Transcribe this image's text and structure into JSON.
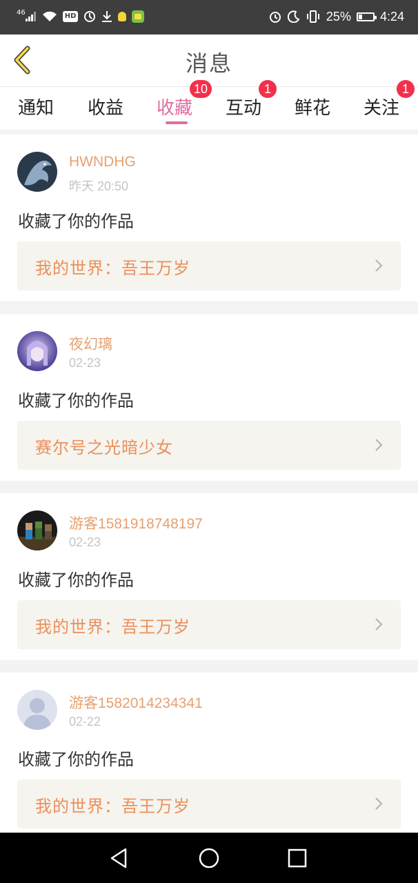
{
  "status_bar": {
    "signal_label": "46",
    "hd_label": "HD",
    "battery": "25%",
    "battery_level": 0.25,
    "time": "4:24",
    "icons": [
      "signal-icon",
      "wifi-icon",
      "hd-icon",
      "data-saver-icon",
      "download-icon",
      "bulb-icon",
      "app-icon",
      "alarm-icon",
      "moon-icon",
      "vibrate-icon",
      "battery-icon"
    ]
  },
  "header": {
    "title": "消息",
    "back_icon": "chevron-left-icon"
  },
  "tabs": [
    {
      "label": "通知",
      "badge": "",
      "active": false
    },
    {
      "label": "收益",
      "badge": "",
      "active": false
    },
    {
      "label": "收藏",
      "badge": "10",
      "active": true
    },
    {
      "label": "互动",
      "badge": "1",
      "active": false
    },
    {
      "label": "鲜花",
      "badge": "",
      "active": false
    },
    {
      "label": "关注",
      "badge": "1",
      "active": false
    }
  ],
  "messages": [
    {
      "username": "HWNDHG",
      "time": "昨天 20:50",
      "action": "收藏了你的作品",
      "work": "我的世界：吾王万岁",
      "avatar": "dragon-avatar"
    },
    {
      "username": "夜幻璃",
      "time": "02-23",
      "action": "收藏了你的作品",
      "work": "赛尔号之光暗少女",
      "avatar": "anime-girl-avatar"
    },
    {
      "username": "游客1581918748197",
      "time": "02-23",
      "action": "收藏了你的作品",
      "work": "我的世界：吾王万岁",
      "avatar": "minecraft-avatar"
    },
    {
      "username": "游客1582014234341",
      "time": "02-22",
      "action": "收藏了你的作品",
      "work": "我的世界：吾王万岁",
      "avatar": "default-avatar"
    }
  ],
  "colors": {
    "accent": "#e36aa3",
    "badge": "#f2304b",
    "username": "#e8a070",
    "work_title": "#ed8e5a",
    "work_bg": "#f5f4ee"
  },
  "nav": [
    "back-triangle-icon",
    "home-circle-icon",
    "recents-square-icon"
  ]
}
